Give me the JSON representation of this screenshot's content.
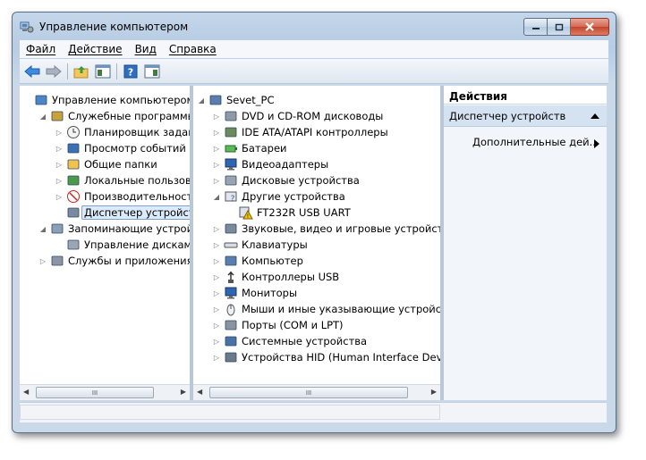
{
  "window": {
    "title": "Управление компьютером"
  },
  "menu": [
    "Файл",
    "Действие",
    "Вид",
    "Справка"
  ],
  "left_tree": [
    {
      "label": "Управление компьютером (л",
      "indent": 0,
      "exp": "",
      "icon": "computer-management-icon"
    },
    {
      "label": "Служебные программы",
      "indent": 1,
      "exp": "◢",
      "icon": "tools-icon"
    },
    {
      "label": "Планировщик заданий",
      "indent": 2,
      "exp": "▷",
      "icon": "clock-icon"
    },
    {
      "label": "Просмотр событий",
      "indent": 2,
      "exp": "▷",
      "icon": "event-viewer-icon"
    },
    {
      "label": "Общие папки",
      "indent": 2,
      "exp": "▷",
      "icon": "shared-folder-icon"
    },
    {
      "label": "Локальные пользовате",
      "indent": 2,
      "exp": "▷",
      "icon": "users-icon"
    },
    {
      "label": "Производительность",
      "indent": 2,
      "exp": "▷",
      "icon": "performance-icon"
    },
    {
      "label": "Диспетчер устройств",
      "indent": 2,
      "exp": "",
      "icon": "device-manager-icon",
      "selected": true
    },
    {
      "label": "Запоминающие устройст",
      "indent": 1,
      "exp": "◢",
      "icon": "storage-icon"
    },
    {
      "label": "Управление дисками",
      "indent": 2,
      "exp": "",
      "icon": "disk-icon"
    },
    {
      "label": "Службы и приложения",
      "indent": 1,
      "exp": "▷",
      "icon": "services-icon"
    }
  ],
  "device_tree": [
    {
      "label": "Sevet_PC",
      "indent": 0,
      "exp": "◢",
      "icon": "computer-icon"
    },
    {
      "label": "DVD и CD-ROM дисководы",
      "indent": 1,
      "exp": "▷",
      "icon": "dvd-drive-icon"
    },
    {
      "label": "IDE ATA/ATAPI контроллеры",
      "indent": 1,
      "exp": "▷",
      "icon": "ide-controller-icon"
    },
    {
      "label": "Батареи",
      "indent": 1,
      "exp": "▷",
      "icon": "battery-icon"
    },
    {
      "label": "Видеоадаптеры",
      "indent": 1,
      "exp": "▷",
      "icon": "display-adapter-icon"
    },
    {
      "label": "Дисковые устройства",
      "indent": 1,
      "exp": "▷",
      "icon": "disk-drive-icon"
    },
    {
      "label": "Другие устройства",
      "indent": 1,
      "exp": "◢",
      "icon": "unknown-device-icon"
    },
    {
      "label": "FT232R USB UART",
      "indent": 2,
      "exp": "",
      "icon": "warning-device-icon"
    },
    {
      "label": "Звуковые, видео и игровые устройства",
      "indent": 1,
      "exp": "▷",
      "icon": "sound-icon"
    },
    {
      "label": "Клавиатуры",
      "indent": 1,
      "exp": "▷",
      "icon": "keyboard-icon"
    },
    {
      "label": "Компьютер",
      "indent": 1,
      "exp": "▷",
      "icon": "computer-icon"
    },
    {
      "label": "Контроллеры USB",
      "indent": 1,
      "exp": "▷",
      "icon": "usb-icon"
    },
    {
      "label": "Мониторы",
      "indent": 1,
      "exp": "▷",
      "icon": "monitor-icon"
    },
    {
      "label": "Мыши и иные указывающие устройс",
      "indent": 1,
      "exp": "▷",
      "icon": "mouse-icon"
    },
    {
      "label": "Порты (COM и LPT)",
      "indent": 1,
      "exp": "▷",
      "icon": "port-icon"
    },
    {
      "label": "Системные устройства",
      "indent": 1,
      "exp": "▷",
      "icon": "system-device-icon"
    },
    {
      "label": "Устройства HID (Human Interface Devi",
      "indent": 1,
      "exp": "▷",
      "icon": "hid-icon"
    }
  ],
  "actions": {
    "header": "Действия",
    "section": "Диспетчер устройств",
    "item": "Дополнительные дей..."
  },
  "scroll_thumb_label": "III",
  "colors": {
    "selection": "#dcebfc",
    "accent": "#1e6fd0"
  }
}
